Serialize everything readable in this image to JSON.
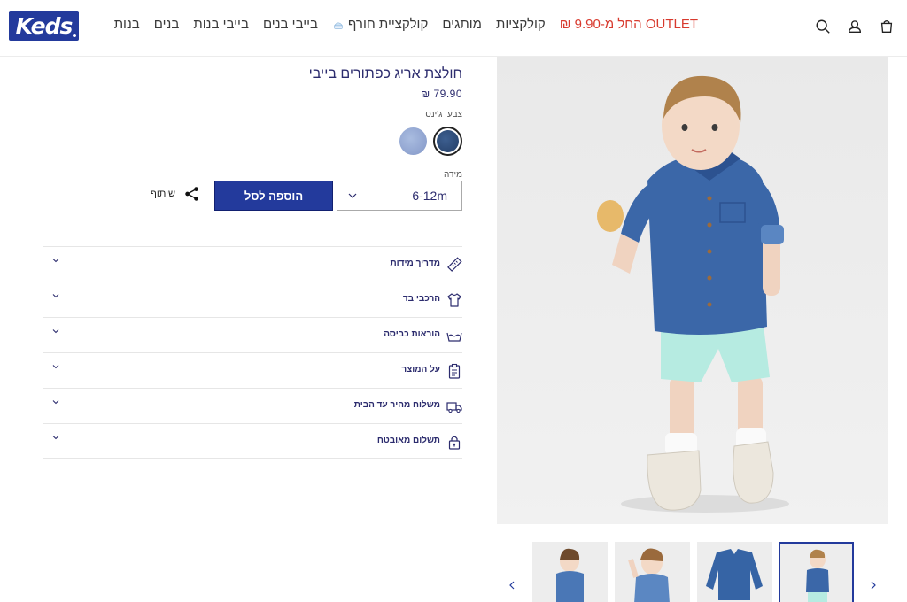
{
  "brand": {
    "logo_text": "Keds"
  },
  "nav": {
    "items": [
      {
        "label": "בנות"
      },
      {
        "label": "בנים"
      },
      {
        "label": "בייבי בנות"
      },
      {
        "label": "בייבי בנים"
      },
      {
        "label": "קולקציית חורף"
      },
      {
        "label": "מותגים"
      },
      {
        "label": "קולקציות"
      },
      {
        "label": "OUTLET החל מ-9.90 ₪"
      }
    ]
  },
  "header_icons": [
    "search-icon",
    "account-icon",
    "cart-icon"
  ],
  "product": {
    "title": "חולצת אריג כפתורים בייבי",
    "price": "79.90 ₪",
    "color_label": "צבע: ג'ינס",
    "swatches": [
      {
        "name": "ג'ינס כהה",
        "color": "#2f4d7a",
        "selected": true
      },
      {
        "name": "ג'ינס בהיר",
        "color": "#9aaed6",
        "selected": false
      }
    ],
    "size_label": "מידה",
    "size_value": "6-12m",
    "add_to_cart": "הוספה לסל",
    "share_label": "שיתוף"
  },
  "accordion": [
    {
      "label": "מדריך מידות",
      "icon": "ruler-icon"
    },
    {
      "label": "הרכבי בד",
      "icon": "shirt-icon"
    },
    {
      "label": "הוראות כביסה",
      "icon": "washing-icon"
    },
    {
      "label": "על המוצר",
      "icon": "clipboard-icon"
    },
    {
      "label": "משלוח מהיר עד הבית",
      "icon": "truck-icon"
    },
    {
      "label": "תשלום מאובטח",
      "icon": "lock-icon"
    }
  ],
  "colors": {
    "brand_blue": "#233a9c",
    "text_navy": "#2c2c6e",
    "sale_red": "#d83a2e"
  }
}
